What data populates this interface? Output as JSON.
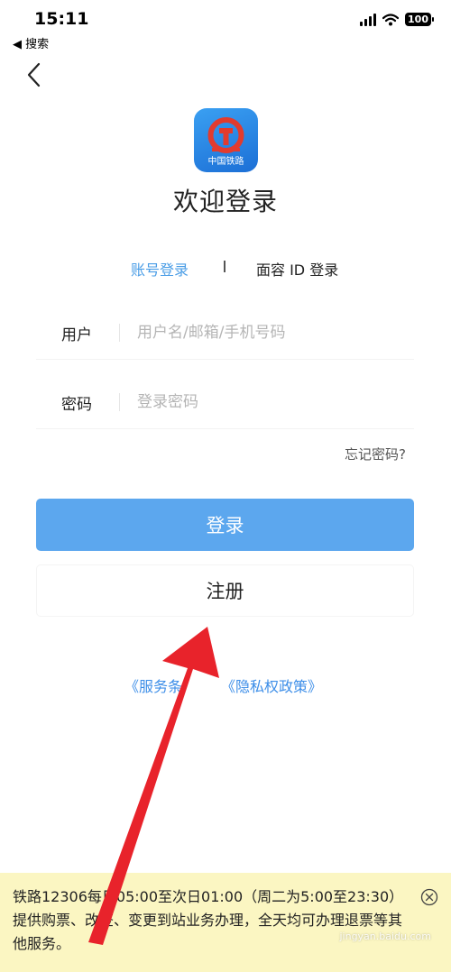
{
  "status_bar": {
    "time": "15:11",
    "back_app_label": "◀ 搜索",
    "battery": "100"
  },
  "header": {
    "welcome_title": "欢迎登录",
    "logo_text": "中国铁路"
  },
  "tabs": [
    {
      "label": "账号登录",
      "active": true
    },
    {
      "label": "面容 ID 登录",
      "active": false
    }
  ],
  "form": {
    "user": {
      "label": "用户",
      "value": "",
      "placeholder": "用户名/邮箱/手机号码"
    },
    "password": {
      "label": "密码",
      "value": "",
      "placeholder": "登录密码"
    },
    "forgot_password": "忘记密码?"
  },
  "buttons": {
    "login": "登录",
    "register": "注册"
  },
  "links": {
    "service": "《服务条",
    "privacy": "《隐私权政策》"
  },
  "notice": {
    "text": "铁路12306每日05:00至次日01:00（周二为5:00至23:30）提供购票、改签、变更到站业务办理，全天均可办理退票等其他服务。",
    "watermark": "jingyan.baidu.com"
  },
  "colors": {
    "accent": "#4a9de6",
    "login_button": "#5ca7ee",
    "link": "#3d8ee8",
    "notice_bg": "#fbf6c2",
    "annotation_arrow": "#e8232b",
    "logo_emblem": "#e23b2e"
  },
  "icons": [
    "back-chevron-icon",
    "signal-icon",
    "wifi-icon",
    "battery-icon",
    "railway-logo-icon",
    "close-circle-icon",
    "red-arrow-annotation"
  ]
}
